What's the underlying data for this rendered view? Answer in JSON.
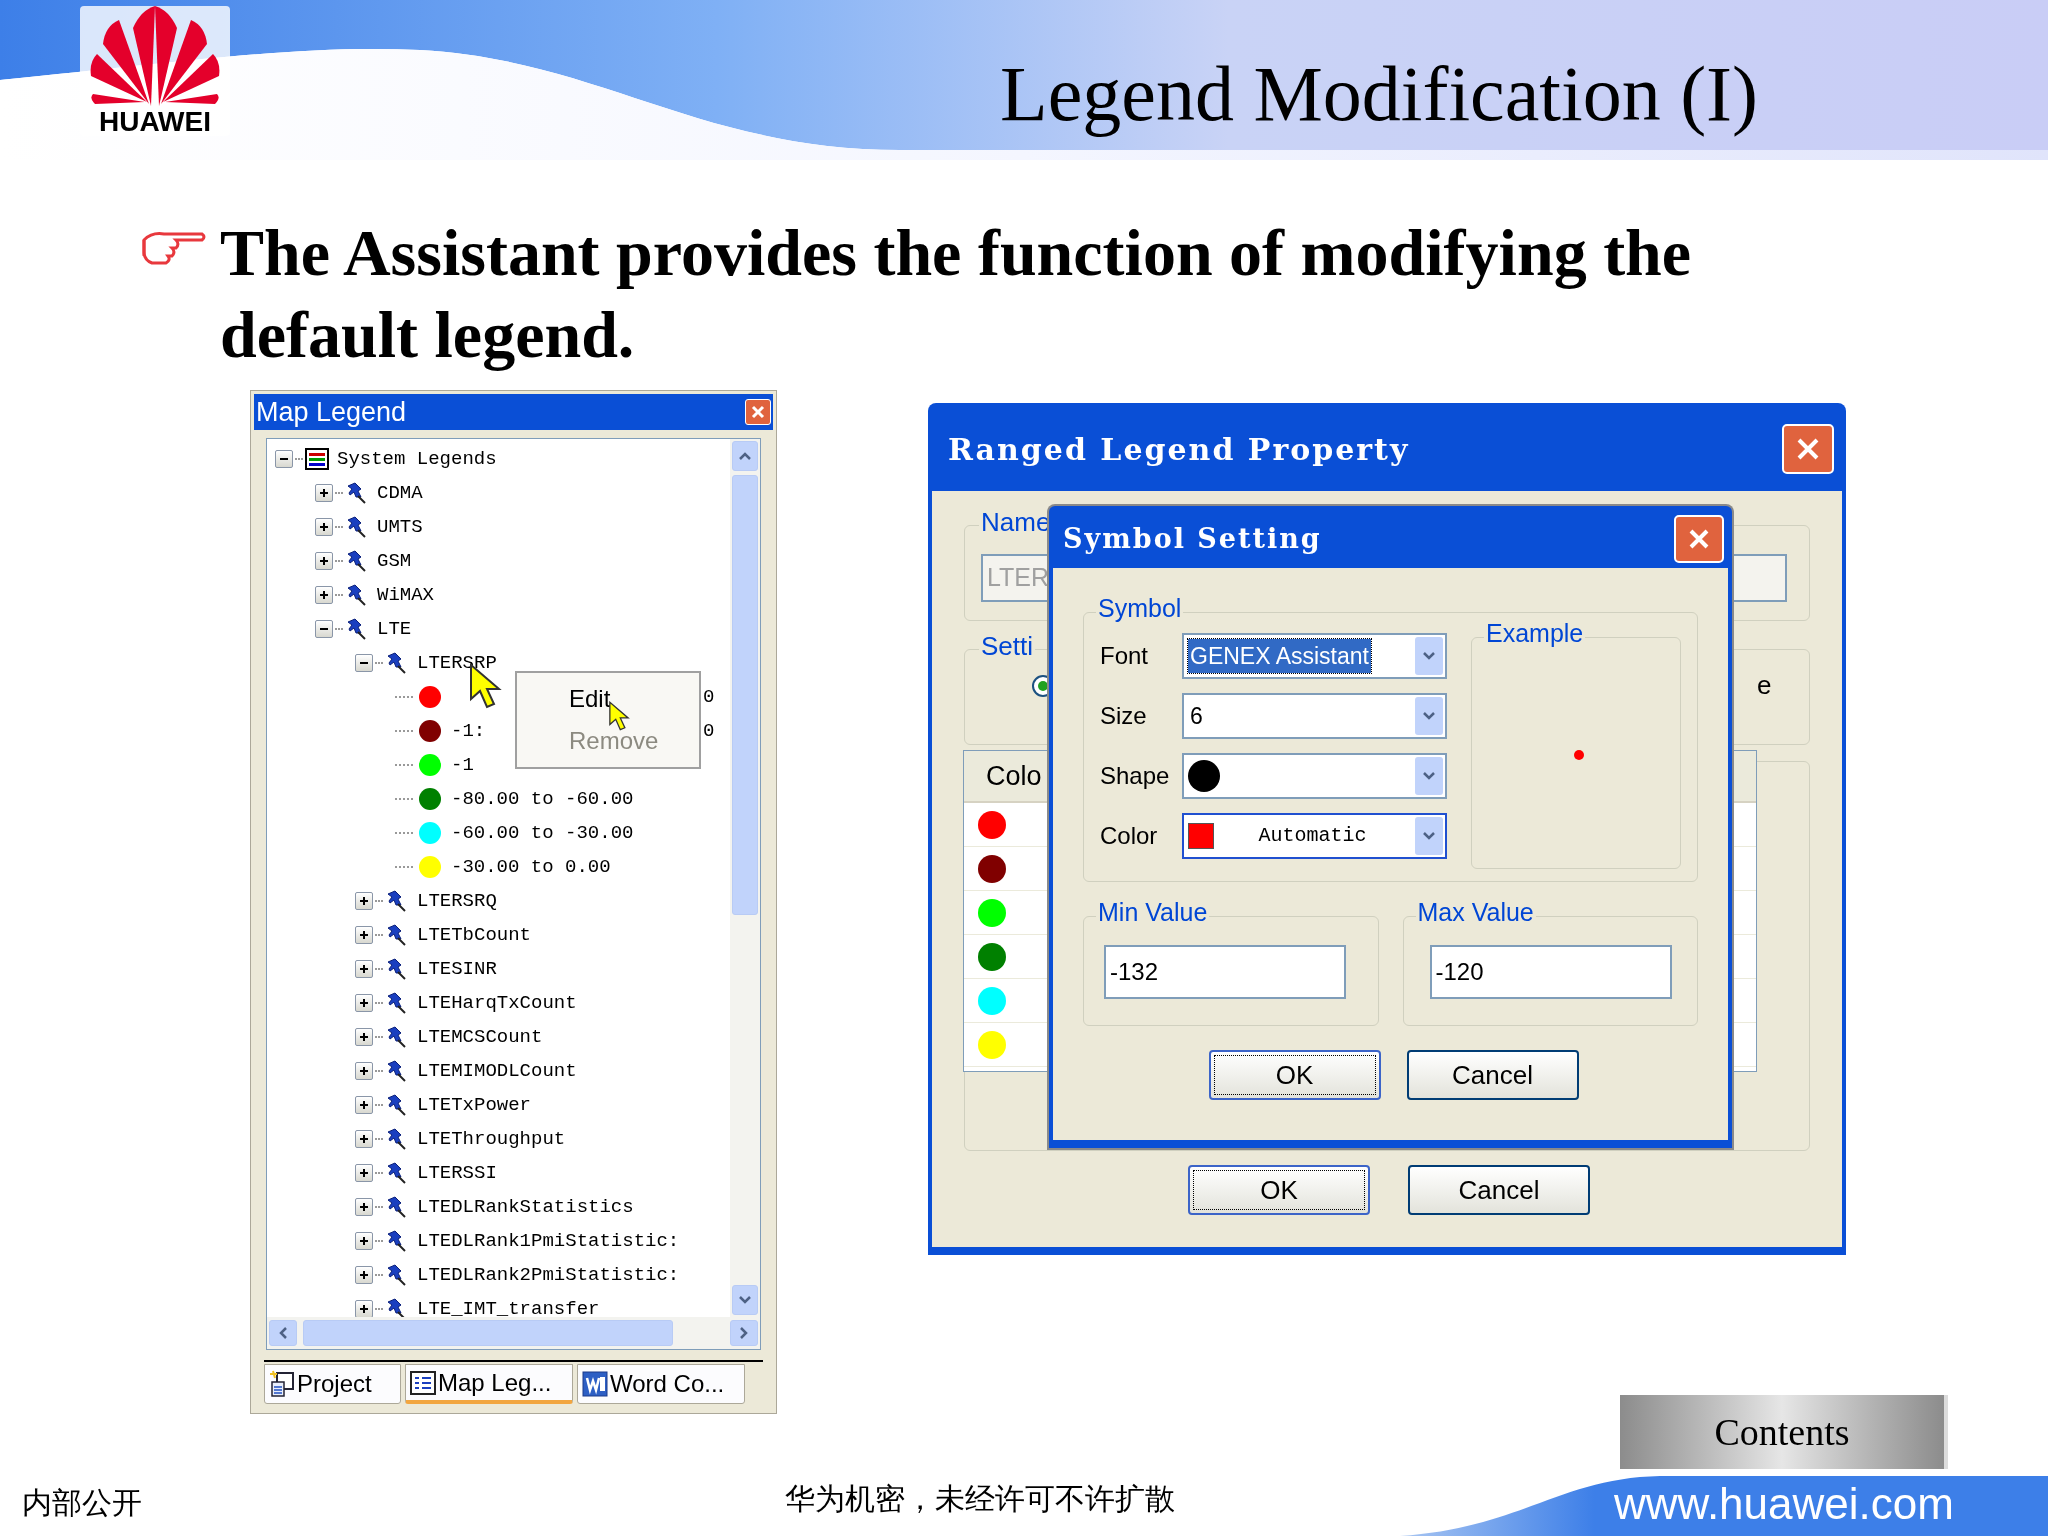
{
  "slide": {
    "logo_text": "HUAWEI",
    "title": "Legend Modification (I)",
    "bullet": "The Assistant provides the function of modifying the default legend."
  },
  "map_legend": {
    "title": "Map Legend",
    "tree": [
      {
        "kind": "folder",
        "label": "System Legends",
        "expanded": true,
        "children": [
          {
            "kind": "legend",
            "label": "CDMA",
            "expanded": false
          },
          {
            "kind": "legend",
            "label": "UMTS",
            "expanded": false
          },
          {
            "kind": "legend",
            "label": "GSM",
            "expanded": false
          },
          {
            "kind": "legend",
            "label": "WiMAX",
            "expanded": false
          },
          {
            "kind": "legend",
            "label": "LTE",
            "expanded": true,
            "children": [
              {
                "kind": "legend",
                "label": "LTERSRP",
                "expanded": true,
                "children": [
                  {
                    "kind": "range",
                    "color": "#ff0000",
                    "tail": "0"
                  },
                  {
                    "kind": "range",
                    "color": "#800000",
                    "label": "-1:",
                    "tail": "0"
                  },
                  {
                    "kind": "range",
                    "color": "#00ff00",
                    "label": "-1"
                  },
                  {
                    "kind": "range",
                    "color": "#008000",
                    "label": "-80.00 to -60.00"
                  },
                  {
                    "kind": "range",
                    "color": "#00ffff",
                    "label": "-60.00 to -30.00"
                  },
                  {
                    "kind": "range",
                    "color": "#ffff00",
                    "label": "-30.00 to 0.00"
                  }
                ]
              },
              {
                "kind": "legend",
                "label": "LTERSRQ",
                "expanded": false
              },
              {
                "kind": "legend",
                "label": "LTETbCount",
                "expanded": false
              },
              {
                "kind": "legend",
                "label": "LTESINR",
                "expanded": false
              },
              {
                "kind": "legend",
                "label": "LTEHarqTxCount",
                "expanded": false
              },
              {
                "kind": "legend",
                "label": "LTEMCSCount",
                "expanded": false
              },
              {
                "kind": "legend",
                "label": "LTEMIMODLCount",
                "expanded": false
              },
              {
                "kind": "legend",
                "label": "LTETxPower",
                "expanded": false
              },
              {
                "kind": "legend",
                "label": "LTEThroughput",
                "expanded": false
              },
              {
                "kind": "legend",
                "label": "LTERSSI",
                "expanded": false
              },
              {
                "kind": "legend",
                "label": "LTEDLRankStatistics",
                "expanded": false
              },
              {
                "kind": "legend",
                "label": "LTEDLRank1PmiStatistic:",
                "expanded": false
              },
              {
                "kind": "legend",
                "label": "LTEDLRank2PmiStatistic:",
                "expanded": false
              },
              {
                "kind": "legend",
                "label": "LTE_IMT_transfer",
                "expanded": false
              }
            ]
          }
        ]
      }
    ],
    "context_menu": [
      {
        "label": "Edit",
        "disabled": false
      },
      {
        "label": "Remove",
        "disabled": true
      }
    ],
    "tabs": [
      {
        "kind": "project",
        "label": "Project",
        "selected": false
      },
      {
        "kind": "legend",
        "label": "Map Leg...",
        "selected": true
      },
      {
        "kind": "word",
        "label": "Word Co...",
        "selected": false
      }
    ]
  },
  "ranged_dialog": {
    "title": "Ranged Legend Property",
    "name_label": "Name",
    "name_value": "LTER",
    "setting_label": "Setti",
    "setting_fragment": "e",
    "color_header": "Colo",
    "setting_radio": {
      "selected": true
    },
    "colors": [
      {
        "color": "#ff0000"
      },
      {
        "color": "#800000"
      },
      {
        "color": "#00ff00"
      },
      {
        "color": "#008000"
      },
      {
        "color": "#00ffff"
      },
      {
        "color": "#ffff00"
      }
    ],
    "buttons": [
      {
        "label": "OK",
        "default": true
      },
      {
        "label": "Cancel",
        "default": false
      }
    ]
  },
  "symbol_dialog": {
    "title": "Symbol Setting",
    "symbol_label": "Symbol",
    "fields": [
      {
        "kind": "text",
        "label": "Font",
        "value": "GENEX Assistant",
        "focused": true
      },
      {
        "kind": "text",
        "label": "Size",
        "value": "6",
        "focused": false
      },
      {
        "kind": "shape",
        "label": "Shape"
      },
      {
        "kind": "color",
        "label": "Color",
        "color": "#ff0000",
        "value": "Automatic"
      }
    ],
    "example_label": "Example",
    "example_symbol": {
      "color": "#ff0000"
    },
    "min_label": "Min Value",
    "min_value": "-132",
    "max_label": "Max Value",
    "max_value": "-120",
    "buttons": [
      {
        "label": "OK",
        "default": true
      },
      {
        "label": "Cancel",
        "default": false
      }
    ]
  },
  "footer": {
    "classification": "内部公开",
    "notice": "华为机密，未经许可不许扩散",
    "contents_button": "Contents",
    "url": "www.huawei.com"
  }
}
